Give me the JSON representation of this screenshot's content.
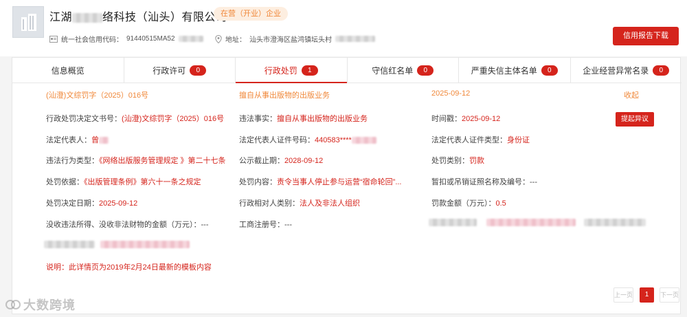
{
  "company": {
    "name_prefix": "江湖",
    "name_suffix": "络科技（汕头）有限公司",
    "status": "在营（开业）企业",
    "credit_code_label": "统一社会信用代码：",
    "credit_code": "91440515MA52",
    "address_label": "地址：",
    "address": "汕头市澄海区盐鸿镇坛头村",
    "report_button": "信用报告下载"
  },
  "tabs": [
    {
      "label": "信息概览",
      "count": null
    },
    {
      "label": "行政许可",
      "count": "0"
    },
    {
      "label": "行政处罚",
      "count": "1"
    },
    {
      "label": "守信红名单",
      "count": "0"
    },
    {
      "label": "严重失信主体名单",
      "count": "0"
    },
    {
      "label": "企业经营异常名录",
      "count": "0"
    }
  ],
  "active_tab": "行政处罚",
  "record": {
    "summary_doc": "(汕澄)文综罚字（2025）016号",
    "summary_fact": "擅自从事出版物的出版业务",
    "summary_date": "2025-09-12",
    "collapse_label": "收起",
    "objection_button": "提起异议",
    "fields": {
      "doc_no_label": "行政处罚决定文书号：",
      "doc_no": "(汕澄)文综罚字（2025）016号",
      "illegal_fact_label": "违法事实：",
      "illegal_fact": "擅自从事出版物的出版业务",
      "timestamp_label": "时间戳：",
      "timestamp": "2025-09-12",
      "legal_rep_label": "法定代表人：",
      "legal_rep": "曾",
      "legal_rep_id_label": "法定代表人证件号码：",
      "legal_rep_id": "440583****",
      "legal_rep_id_type_label": "法定代表人证件类型：",
      "legal_rep_id_type": "身份证",
      "violation_type_label": "违法行为类型：",
      "violation_type": "《网络出版服务管理规定 》第二十七条",
      "publicity_end_label": "公示截止期：",
      "publicity_end": "2028-09-12",
      "penalty_category_label": "处罚类别：",
      "penalty_category": "罚款",
      "basis_label": "处罚依据：",
      "basis": "《出版管理条例》第六十一条之规定",
      "penalty_content_label": "处罚内容：",
      "penalty_content": "责令当事人停止参与运营“宿命轮回”...",
      "license_label": "暂扣或吊销证照名称及编号：",
      "license": "---",
      "decision_date_label": "处罚决定日期：",
      "decision_date": "2025-09-12",
      "counterpart_type_label": "行政相对人类别：",
      "counterpart_type": "法人及非法人组织",
      "fine_label": "罚款金额（万元）：",
      "fine": "0.5",
      "confiscation_label": "没收违法所得、没收非法财物的金额（万元）：",
      "confiscation": "---",
      "reg_no_label": "工商注册号：",
      "reg_no": "---"
    },
    "note": "说明：此详情页为2019年2月24日最新的模板内容"
  },
  "pagination": {
    "prev": "上一页",
    "current": "1",
    "next": "下一页"
  },
  "watermark": "大数跨境",
  "colors": {
    "accent": "#d5241c",
    "orange": "#f0883a"
  }
}
